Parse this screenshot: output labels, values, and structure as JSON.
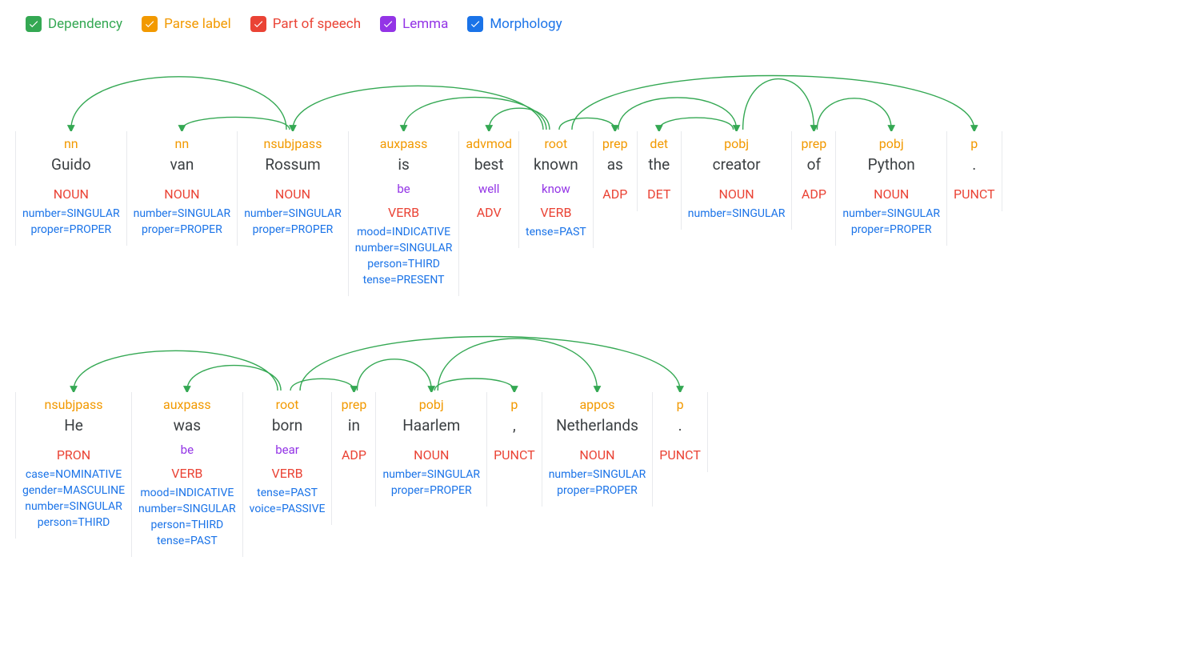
{
  "legend": {
    "dependency": "Dependency",
    "parse_label": "Parse label",
    "pos": "Part of speech",
    "lemma": "Lemma",
    "morphology": "Morphology"
  },
  "colors": {
    "dependency": "#34a853",
    "parse_label": "#f29900",
    "pos": "#ea4335",
    "lemma": "#9334e6",
    "morphology": "#1a73e8"
  },
  "sentences": [
    {
      "tokens": [
        {
          "parse": "nn",
          "text": "Guido",
          "lemma": "",
          "pos": "NOUN",
          "morph": [
            "number=SINGULAR",
            "proper=PROPER"
          ],
          "head": 2
        },
        {
          "parse": "nn",
          "text": "van",
          "lemma": "",
          "pos": "NOUN",
          "morph": [
            "number=SINGULAR",
            "proper=PROPER"
          ],
          "head": 2
        },
        {
          "parse": "nsubjpass",
          "text": "Rossum",
          "lemma": "",
          "pos": "NOUN",
          "morph": [
            "number=SINGULAR",
            "proper=PROPER"
          ],
          "head": 5
        },
        {
          "parse": "auxpass",
          "text": "is",
          "lemma": "be",
          "pos": "VERB",
          "morph": [
            "mood=INDICATIVE",
            "number=SINGULAR",
            "person=THIRD",
            "tense=PRESENT"
          ],
          "head": 5
        },
        {
          "parse": "advmod",
          "text": "best",
          "lemma": "well",
          "pos": "ADV",
          "morph": [],
          "head": 5
        },
        {
          "parse": "root",
          "text": "known",
          "lemma": "know",
          "pos": "VERB",
          "morph": [
            "tense=PAST"
          ],
          "head": -1
        },
        {
          "parse": "prep",
          "text": "as",
          "lemma": "",
          "pos": "ADP",
          "morph": [],
          "head": 5
        },
        {
          "parse": "det",
          "text": "the",
          "lemma": "",
          "pos": "DET",
          "morph": [],
          "head": 8
        },
        {
          "parse": "pobj",
          "text": "creator",
          "lemma": "",
          "pos": "NOUN",
          "morph": [
            "number=SINGULAR"
          ],
          "head": 6
        },
        {
          "parse": "prep",
          "text": "of",
          "lemma": "",
          "pos": "ADP",
          "morph": [],
          "head": 8
        },
        {
          "parse": "pobj",
          "text": "Python",
          "lemma": "",
          "pos": "NOUN",
          "morph": [
            "number=SINGULAR",
            "proper=PROPER"
          ],
          "head": 9
        },
        {
          "parse": "p",
          "text": ".",
          "lemma": "",
          "pos": "PUNCT",
          "morph": [],
          "head": 5
        }
      ]
    },
    {
      "tokens": [
        {
          "parse": "nsubjpass",
          "text": "He",
          "lemma": "",
          "pos": "PRON",
          "morph": [
            "case=NOMINATIVE",
            "gender=MASCULINE",
            "number=SINGULAR",
            "person=THIRD"
          ],
          "head": 2
        },
        {
          "parse": "auxpass",
          "text": "was",
          "lemma": "be",
          "pos": "VERB",
          "morph": [
            "mood=INDICATIVE",
            "number=SINGULAR",
            "person=THIRD",
            "tense=PAST"
          ],
          "head": 2
        },
        {
          "parse": "root",
          "text": "born",
          "lemma": "bear",
          "pos": "VERB",
          "morph": [
            "tense=PAST",
            "voice=PASSIVE"
          ],
          "head": -1
        },
        {
          "parse": "prep",
          "text": "in",
          "lemma": "",
          "pos": "ADP",
          "morph": [],
          "head": 2
        },
        {
          "parse": "pobj",
          "text": "Haarlem",
          "lemma": "",
          "pos": "NOUN",
          "morph": [
            "number=SINGULAR",
            "proper=PROPER"
          ],
          "head": 3
        },
        {
          "parse": "p",
          "text": ",",
          "lemma": "",
          "pos": "PUNCT",
          "morph": [],
          "head": 4
        },
        {
          "parse": "appos",
          "text": "Netherlands",
          "lemma": "",
          "pos": "NOUN",
          "morph": [
            "number=SINGULAR",
            "proper=PROPER"
          ],
          "head": 4
        },
        {
          "parse": "p",
          "text": ".",
          "lemma": "",
          "pos": "PUNCT",
          "morph": [],
          "head": 2
        }
      ]
    }
  ]
}
